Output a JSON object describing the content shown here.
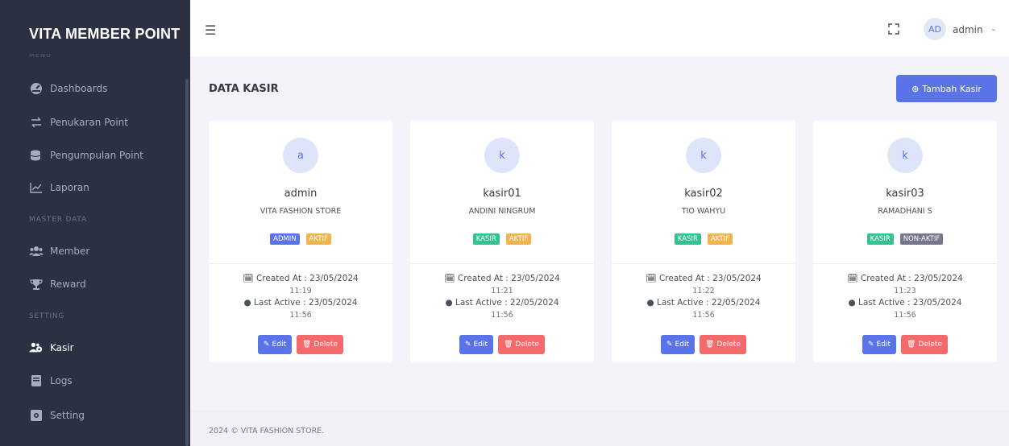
{
  "app": {
    "brand": "VITA MEMBER POINT",
    "menu_label": "MENU"
  },
  "sidebar": {
    "items": [
      {
        "label": "Dashboards",
        "icon": "dashboard-icon"
      },
      {
        "label": "Penukaran Point",
        "icon": "exchange-icon"
      },
      {
        "label": "Pengumpulan Point",
        "icon": "coins-icon"
      },
      {
        "label": "Laporan",
        "icon": "chart-icon"
      },
      {
        "label": "Member",
        "icon": "users-icon"
      },
      {
        "label": "Reward",
        "icon": "trophy-icon"
      },
      {
        "label": "Kasir",
        "icon": "users-cog-icon"
      },
      {
        "label": "Logs",
        "icon": "book-icon"
      },
      {
        "label": "Setting",
        "icon": "gear-icon"
      }
    ],
    "sections": [
      "MASTER DATA",
      "SETTING"
    ]
  },
  "topbar": {
    "avatar_initials": "AD",
    "user": "admin"
  },
  "page": {
    "title": "DATA KASIR",
    "add_button": "Tambah Kasir"
  },
  "cards": [
    {
      "initial": "a",
      "username": "admin",
      "fullname": "VITA FASHION STORE",
      "role": "ADMIN",
      "status": "AKTIF",
      "created": "Created At : 23/05/2024",
      "created_time": "11:19",
      "last": "Last Active : 23/05/2024",
      "last_time": "11:56"
    },
    {
      "initial": "k",
      "username": "kasir01",
      "fullname": "ANDINI NINGRUM",
      "role": "KASIR",
      "status": "AKTIF",
      "created": "Created At : 23/05/2024",
      "created_time": "11:21",
      "last": "Last Active : 22/05/2024",
      "last_time": "11:56"
    },
    {
      "initial": "k",
      "username": "kasir02",
      "fullname": "TIO WAHYU",
      "role": "KASIR",
      "status": "AKTIF",
      "created": "Created At : 23/05/2024",
      "created_time": "11:22",
      "last": "Last Active : 22/05/2024",
      "last_time": "11:56"
    },
    {
      "initial": "k",
      "username": "kasir03",
      "fullname": "RAMADHANI S",
      "role": "KASIR",
      "status": "NON-AKTIF",
      "created": "Created At : 23/05/2024",
      "created_time": "11:23",
      "last": "Last Active : 23/05/2024",
      "last_time": "11:56"
    }
  ],
  "card_actions": {
    "edit": "Edit",
    "delete": "Delete"
  },
  "footer": {
    "text": "2024 © VITA FASHION STORE."
  },
  "colors": {
    "primary": "#5b73e8",
    "success": "#34c38f",
    "warning": "#f1b44c",
    "danger": "#f46a6a",
    "secondary": "#74788d",
    "sidebar": "#2b3042"
  }
}
